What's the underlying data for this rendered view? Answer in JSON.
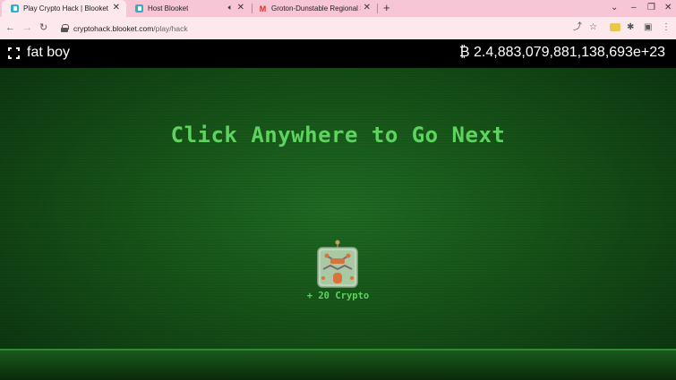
{
  "browser": {
    "tabs": [
      {
        "title": "Play Crypto Hack | Blooket",
        "active": true
      },
      {
        "title": "Host Blooket",
        "active": false
      },
      {
        "title": "Groton-Dunstable Regional Scho",
        "active": false
      }
    ],
    "url_host": "cryptohack.blooket.com",
    "url_path": "/play/hack"
  },
  "header": {
    "username": "fat boy",
    "crypto_total": "₿ 2.4,883,079,881,138,693e+23"
  },
  "game": {
    "prompt": "Click Anywhere to Go Next",
    "reward_text": "+ 20 Crypto",
    "blook_icon": "robot-chest-blook"
  },
  "colors": {
    "accent_green": "#5fd35f",
    "tab_strip": "#f7c6d6",
    "header_bg": "#000000"
  }
}
